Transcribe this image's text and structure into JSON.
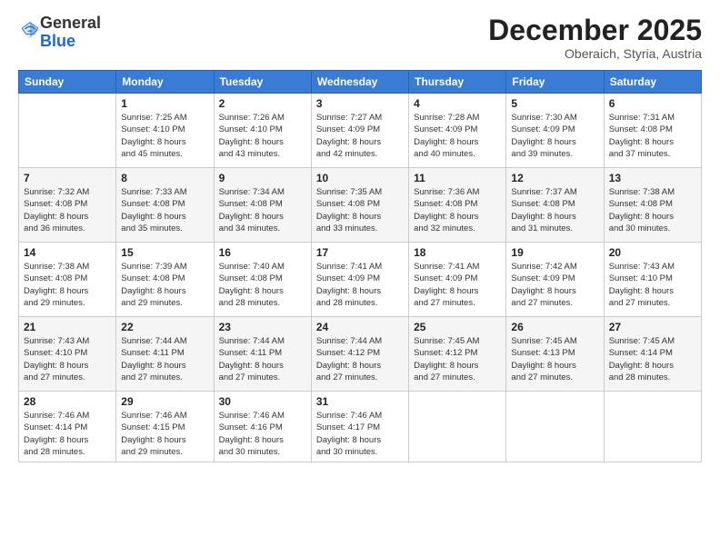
{
  "header": {
    "logo_general": "General",
    "logo_blue": "Blue",
    "month_title": "December 2025",
    "subtitle": "Oberaich, Styria, Austria"
  },
  "days_of_week": [
    "Sunday",
    "Monday",
    "Tuesday",
    "Wednesday",
    "Thursday",
    "Friday",
    "Saturday"
  ],
  "weeks": [
    [
      {
        "num": "",
        "info": ""
      },
      {
        "num": "1",
        "info": "Sunrise: 7:25 AM\nSunset: 4:10 PM\nDaylight: 8 hours\nand 45 minutes."
      },
      {
        "num": "2",
        "info": "Sunrise: 7:26 AM\nSunset: 4:10 PM\nDaylight: 8 hours\nand 43 minutes."
      },
      {
        "num": "3",
        "info": "Sunrise: 7:27 AM\nSunset: 4:09 PM\nDaylight: 8 hours\nand 42 minutes."
      },
      {
        "num": "4",
        "info": "Sunrise: 7:28 AM\nSunset: 4:09 PM\nDaylight: 8 hours\nand 40 minutes."
      },
      {
        "num": "5",
        "info": "Sunrise: 7:30 AM\nSunset: 4:09 PM\nDaylight: 8 hours\nand 39 minutes."
      },
      {
        "num": "6",
        "info": "Sunrise: 7:31 AM\nSunset: 4:08 PM\nDaylight: 8 hours\nand 37 minutes."
      }
    ],
    [
      {
        "num": "7",
        "info": "Sunrise: 7:32 AM\nSunset: 4:08 PM\nDaylight: 8 hours\nand 36 minutes."
      },
      {
        "num": "8",
        "info": "Sunrise: 7:33 AM\nSunset: 4:08 PM\nDaylight: 8 hours\nand 35 minutes."
      },
      {
        "num": "9",
        "info": "Sunrise: 7:34 AM\nSunset: 4:08 PM\nDaylight: 8 hours\nand 34 minutes."
      },
      {
        "num": "10",
        "info": "Sunrise: 7:35 AM\nSunset: 4:08 PM\nDaylight: 8 hours\nand 33 minutes."
      },
      {
        "num": "11",
        "info": "Sunrise: 7:36 AM\nSunset: 4:08 PM\nDaylight: 8 hours\nand 32 minutes."
      },
      {
        "num": "12",
        "info": "Sunrise: 7:37 AM\nSunset: 4:08 PM\nDaylight: 8 hours\nand 31 minutes."
      },
      {
        "num": "13",
        "info": "Sunrise: 7:38 AM\nSunset: 4:08 PM\nDaylight: 8 hours\nand 30 minutes."
      }
    ],
    [
      {
        "num": "14",
        "info": "Sunrise: 7:38 AM\nSunset: 4:08 PM\nDaylight: 8 hours\nand 29 minutes."
      },
      {
        "num": "15",
        "info": "Sunrise: 7:39 AM\nSunset: 4:08 PM\nDaylight: 8 hours\nand 29 minutes."
      },
      {
        "num": "16",
        "info": "Sunrise: 7:40 AM\nSunset: 4:08 PM\nDaylight: 8 hours\nand 28 minutes."
      },
      {
        "num": "17",
        "info": "Sunrise: 7:41 AM\nSunset: 4:09 PM\nDaylight: 8 hours\nand 28 minutes."
      },
      {
        "num": "18",
        "info": "Sunrise: 7:41 AM\nSunset: 4:09 PM\nDaylight: 8 hours\nand 27 minutes."
      },
      {
        "num": "19",
        "info": "Sunrise: 7:42 AM\nSunset: 4:09 PM\nDaylight: 8 hours\nand 27 minutes."
      },
      {
        "num": "20",
        "info": "Sunrise: 7:43 AM\nSunset: 4:10 PM\nDaylight: 8 hours\nand 27 minutes."
      }
    ],
    [
      {
        "num": "21",
        "info": "Sunrise: 7:43 AM\nSunset: 4:10 PM\nDaylight: 8 hours\nand 27 minutes."
      },
      {
        "num": "22",
        "info": "Sunrise: 7:44 AM\nSunset: 4:11 PM\nDaylight: 8 hours\nand 27 minutes."
      },
      {
        "num": "23",
        "info": "Sunrise: 7:44 AM\nSunset: 4:11 PM\nDaylight: 8 hours\nand 27 minutes."
      },
      {
        "num": "24",
        "info": "Sunrise: 7:44 AM\nSunset: 4:12 PM\nDaylight: 8 hours\nand 27 minutes."
      },
      {
        "num": "25",
        "info": "Sunrise: 7:45 AM\nSunset: 4:12 PM\nDaylight: 8 hours\nand 27 minutes."
      },
      {
        "num": "26",
        "info": "Sunrise: 7:45 AM\nSunset: 4:13 PM\nDaylight: 8 hours\nand 27 minutes."
      },
      {
        "num": "27",
        "info": "Sunrise: 7:45 AM\nSunset: 4:14 PM\nDaylight: 8 hours\nand 28 minutes."
      }
    ],
    [
      {
        "num": "28",
        "info": "Sunrise: 7:46 AM\nSunset: 4:14 PM\nDaylight: 8 hours\nand 28 minutes."
      },
      {
        "num": "29",
        "info": "Sunrise: 7:46 AM\nSunset: 4:15 PM\nDaylight: 8 hours\nand 29 minutes."
      },
      {
        "num": "30",
        "info": "Sunrise: 7:46 AM\nSunset: 4:16 PM\nDaylight: 8 hours\nand 30 minutes."
      },
      {
        "num": "31",
        "info": "Sunrise: 7:46 AM\nSunset: 4:17 PM\nDaylight: 8 hours\nand 30 minutes."
      },
      {
        "num": "",
        "info": ""
      },
      {
        "num": "",
        "info": ""
      },
      {
        "num": "",
        "info": ""
      }
    ]
  ]
}
